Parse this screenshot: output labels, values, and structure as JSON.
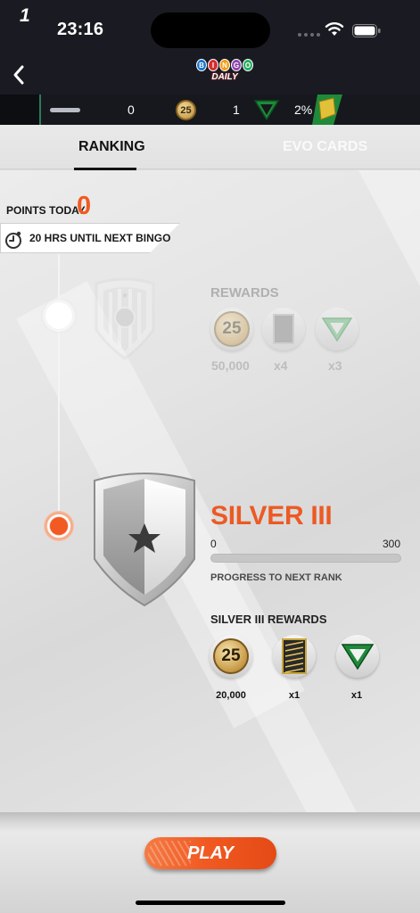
{
  "status_bar": {
    "time": "23:16"
  },
  "header": {
    "logo_balls": [
      "B",
      "I",
      "N",
      "G",
      "O"
    ],
    "logo_sub": "DAILY"
  },
  "stats": {
    "level": "1",
    "xp_value": "0",
    "coin_badge": "25",
    "evo_count": "1",
    "percent": "2%"
  },
  "tabs": [
    {
      "label": "RANKING",
      "active": true
    },
    {
      "label": "EVO CARDS",
      "active": false
    }
  ],
  "points_today": {
    "label": "POINTS TODAY",
    "value": "0"
  },
  "timer": {
    "text": "20 HRS UNTIL NEXT BINGO"
  },
  "next_rank": {
    "rewards_title": "REWARDS",
    "coin_badge": "25",
    "rewards": [
      {
        "icon": "coin-icon",
        "value": "50,000"
      },
      {
        "icon": "card-pack-icon",
        "value": "x4"
      },
      {
        "icon": "evo-triangle-icon",
        "value": "x3"
      }
    ]
  },
  "current_rank": {
    "name": "SILVER III",
    "progress_min": "0",
    "progress_max": "300",
    "progress_value": 0,
    "progress_label": "PROGRESS TO NEXT RANK",
    "rewards_title": "SILVER III REWARDS",
    "coin_badge": "25",
    "rewards": [
      {
        "icon": "coin-icon",
        "value": "20,000"
      },
      {
        "icon": "card-pack-icon",
        "value": "x1"
      },
      {
        "icon": "evo-triangle-icon",
        "value": "x1"
      }
    ]
  },
  "play_button": {
    "label": "PLAY"
  },
  "colors": {
    "accent": "#f15a22",
    "dark_bar": "#1a1b22",
    "evo_green": "#1f8a3a",
    "gold": "#c69a45"
  }
}
